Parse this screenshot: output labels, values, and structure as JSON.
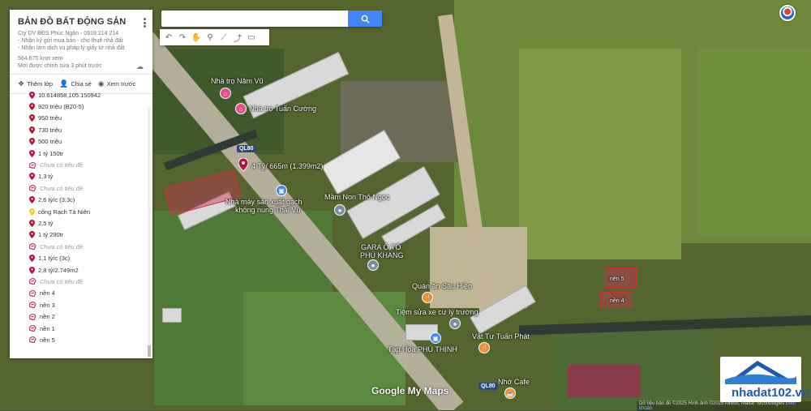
{
  "panel": {
    "title": "BẢN ĐỒ BẤT ĐỘNG SẢN",
    "description_lines": [
      "Cty DV BĐS Phúc Ngân - 0919 214 214",
      "- Nhận ký gửi mua bán - cho thuê nhà đất",
      "- Nhận làm dịch vụ pháp lý giấy tờ nhà đất"
    ],
    "views": "564.675 lượt xem",
    "edited": "Mới được chỉnh sửa 3 phút trước",
    "actions": {
      "add_layer": "Thêm lớp",
      "share": "Chia sẻ",
      "preview": "Xem trước"
    },
    "items": [
      {
        "type": "pin",
        "color": "#b3123a",
        "label": "10.614858,105.150942"
      },
      {
        "type": "pin",
        "color": "#b3123a",
        "label": "920 triệu (B20-5)"
      },
      {
        "type": "pin",
        "color": "#b3123a",
        "label": "950 triệu"
      },
      {
        "type": "pin",
        "color": "#b3123a",
        "label": "730 triệu"
      },
      {
        "type": "pin",
        "color": "#b3123a",
        "label": "500 triệu"
      },
      {
        "type": "pin",
        "color": "#b3123a",
        "label": "1 tỷ 150tr"
      },
      {
        "type": "shape",
        "color": "#c0395f",
        "label": "Chưa có tiêu đề"
      },
      {
        "type": "pin",
        "color": "#b3123a",
        "label": "1,3 tỷ"
      },
      {
        "type": "shape",
        "color": "#c0395f",
        "label": "Chưa có tiêu đề"
      },
      {
        "type": "pin",
        "color": "#b3123a",
        "label": "2,6 tỷ/c (3,3c)"
      },
      {
        "type": "pin",
        "color": "#f2d027",
        "label": "cống Rạch Tà Niên"
      },
      {
        "type": "pin",
        "color": "#b3123a",
        "label": "2,5 tỷ"
      },
      {
        "type": "pin",
        "color": "#b3123a",
        "label": "1 tỷ 290tr"
      },
      {
        "type": "shape",
        "color": "#c0395f",
        "label": "Chưa có tiêu đề"
      },
      {
        "type": "pin",
        "color": "#b3123a",
        "label": "1,1 tỷ/c (3c)"
      },
      {
        "type": "pin",
        "color": "#b3123a",
        "label": "2,8 tỷ/2.749m2"
      },
      {
        "type": "shape",
        "color": "#c0395f",
        "label": "Chưa có tiêu đề"
      },
      {
        "type": "shape",
        "color": "#c0395f",
        "label": "nền 4"
      },
      {
        "type": "shape",
        "color": "#c0395f",
        "label": "nền 3"
      },
      {
        "type": "shape",
        "color": "#c0395f",
        "label": "nền 2"
      },
      {
        "type": "shape",
        "color": "#c0395f",
        "label": "nền 1"
      },
      {
        "type": "shape",
        "color": "#c0395f",
        "label": "nền 5"
      }
    ]
  },
  "search": {
    "placeholder": ""
  },
  "map": {
    "labels": {
      "nha_tro_nam_vu": "Nhà trọ Năm Vũ",
      "nha_tro_tuan_cuong": "Nhà trọ Tuấn Cường",
      "ql80_a": "QL80",
      "ql80_b": "QL80",
      "pin_label": "4 Tỷ/ 665m (1.399m2)",
      "gach": "Nhà máy sản xuất gạch",
      "gach2": "không nung Thái Vũ",
      "mam_non": "Mầm Non Thỏ Ngọc",
      "gara": "GARA Ô TÔ",
      "gara2": "PHÚ KHANG",
      "quan_an": "Quán ăn Sáu Hiền",
      "tiem_sua_xe": "Tiệm sửa xe cư lý trường",
      "vat_tu": "Vật Tư Tuấn Phát",
      "tap_hoa": "Tạp Hóa PHÚ THỊNH",
      "nho_cafe": "Nhớ Cafe",
      "nen_label": "nền 5",
      "nen_label2": "nền 4"
    },
    "attribution": "Dữ liệu bản đồ ©2025 Hình ảnh ©2025 Airbus, Maxar Technologies",
    "terms": "Điều khoản",
    "google_logo": "Google My Maps"
  },
  "watermark": {
    "text": "nhadat102.vn"
  }
}
